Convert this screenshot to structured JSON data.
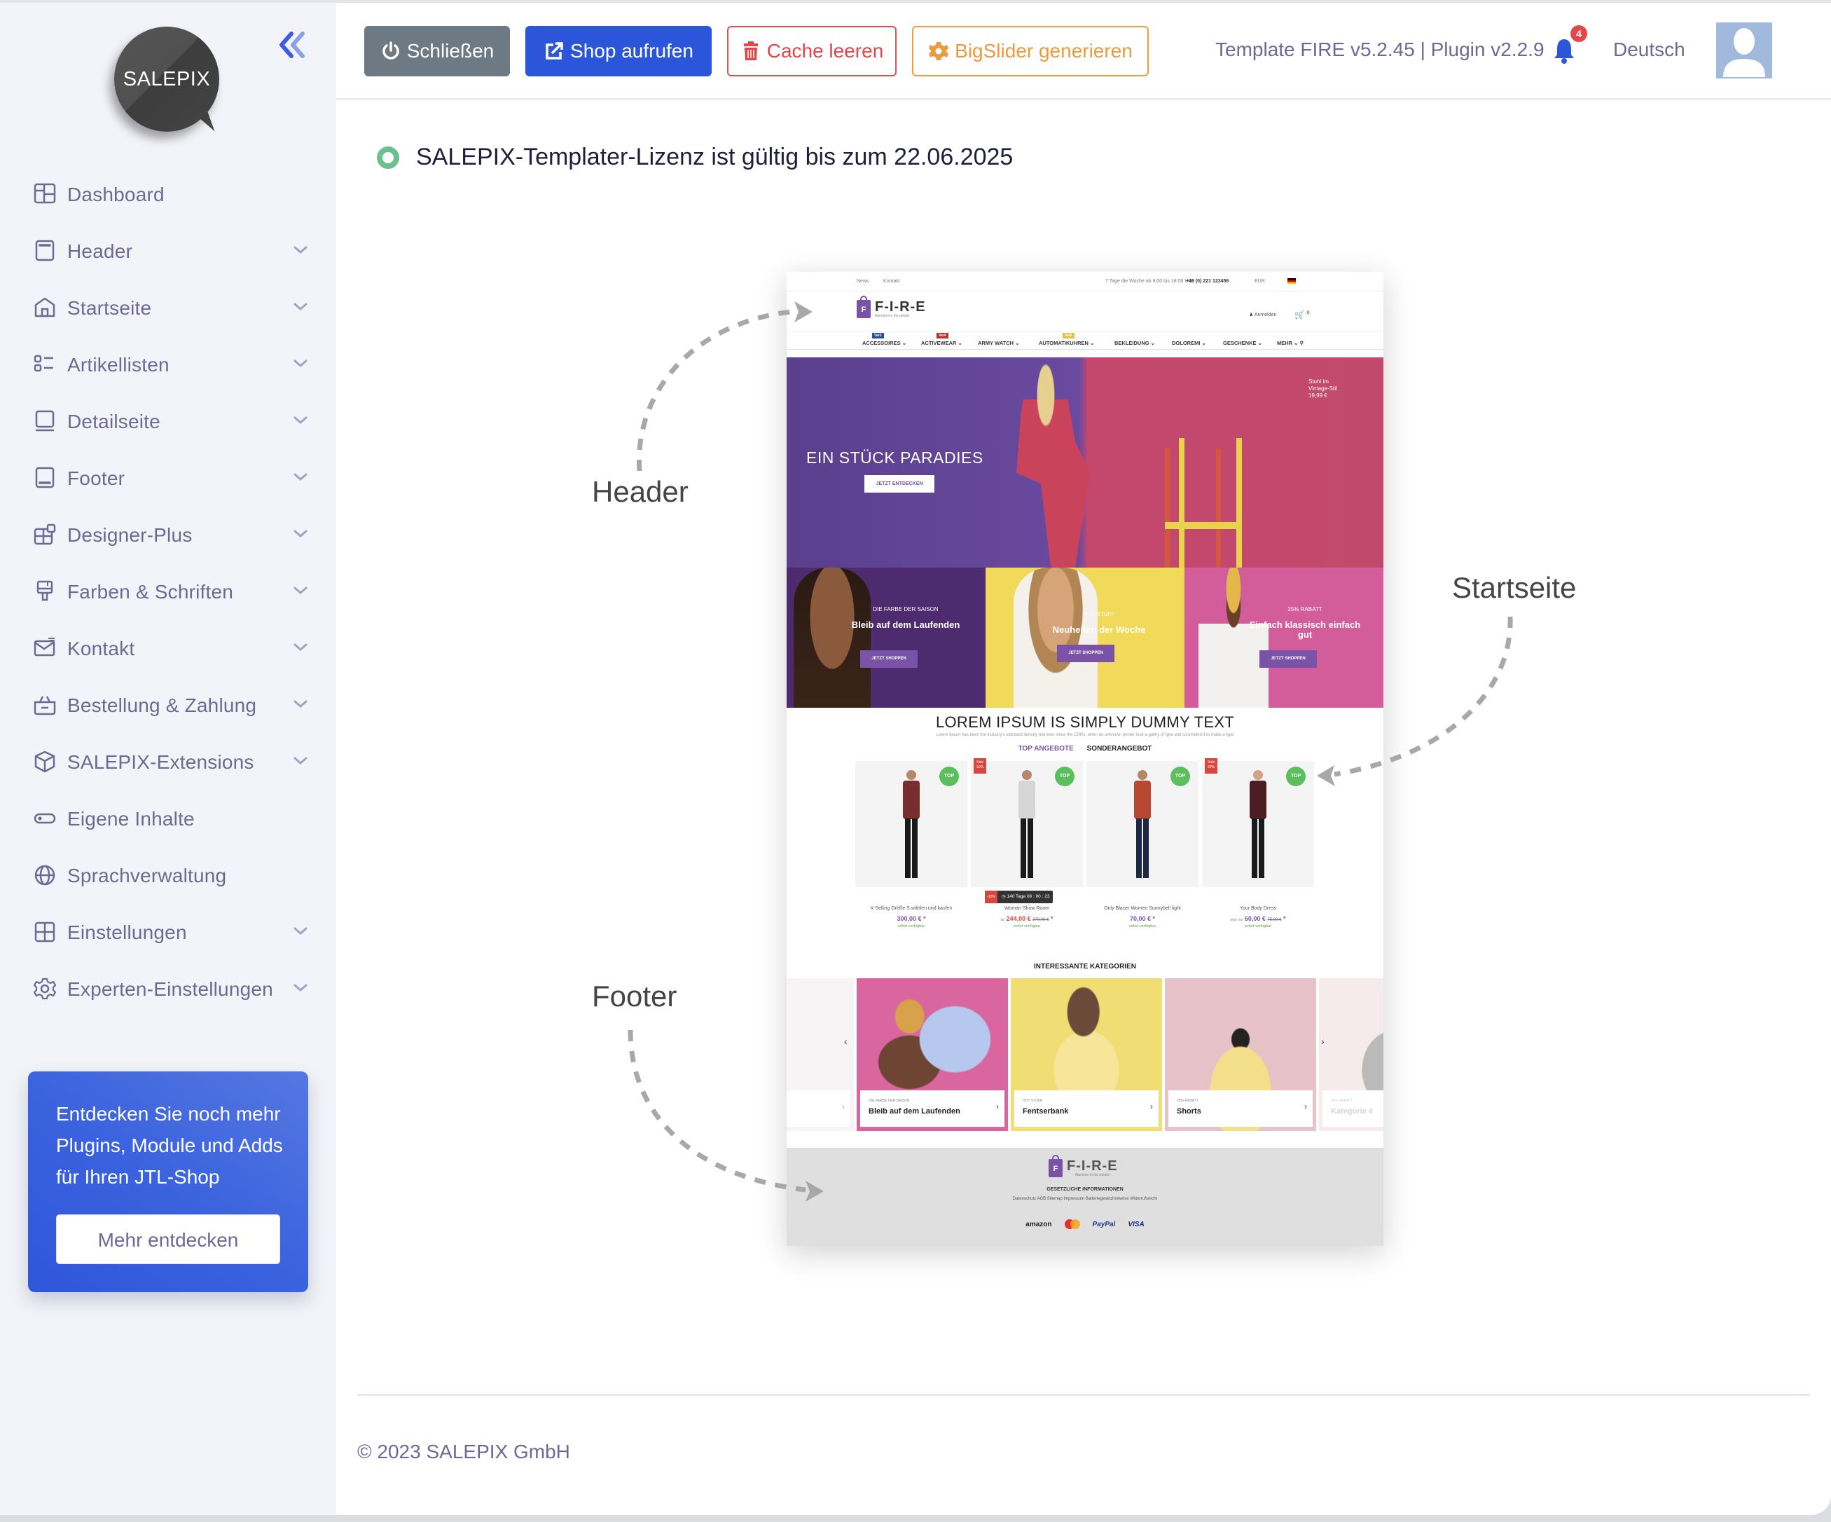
{
  "app": {
    "logo_text": "SALEPIX",
    "collapse_icon": "double-chevron-left-icon"
  },
  "sidebar": {
    "items": [
      {
        "label": "Dashboard",
        "icon": "dashboard-icon",
        "has_submenu": false
      },
      {
        "label": "Header",
        "icon": "header-layout-icon",
        "has_submenu": true
      },
      {
        "label": "Startseite",
        "icon": "home-icon",
        "has_submenu": true
      },
      {
        "label": "Artikellisten",
        "icon": "list-icon",
        "has_submenu": true
      },
      {
        "label": "Detailseite",
        "icon": "laptop-icon",
        "has_submenu": true
      },
      {
        "label": "Footer",
        "icon": "footer-layout-icon",
        "has_submenu": true
      },
      {
        "label": "Designer-Plus",
        "icon": "layout-plus-icon",
        "has_submenu": true
      },
      {
        "label": "Farben & Schriften",
        "icon": "paint-brush-icon",
        "has_submenu": true
      },
      {
        "label": "Kontakt",
        "icon": "mail-icon",
        "has_submenu": true
      },
      {
        "label": "Bestellung & Zahlung",
        "icon": "basket-icon",
        "has_submenu": true
      },
      {
        "label": "SALEPIX-Extensions",
        "icon": "box-icon",
        "has_submenu": true
      },
      {
        "label": "Eigene Inhalte",
        "icon": "toggle-icon",
        "has_submenu": false
      },
      {
        "label": "Sprachverwaltung",
        "icon": "globe-icon",
        "has_submenu": false
      },
      {
        "label": "Einstellungen",
        "icon": "grid-icon",
        "has_submenu": true
      },
      {
        "label": "Experten-Einstellungen",
        "icon": "gear-icon",
        "has_submenu": true
      }
    ],
    "promo": {
      "text": "Entdecken Sie noch mehr Plugins, Module und Adds für Ihren JTL-Shop",
      "button_label": "Mehr entdecken"
    }
  },
  "toolbar": {
    "close_label": "Schließen",
    "shop_label": "Shop aufrufen",
    "cache_label": "Cache leeren",
    "bigslider_label": "BigSlider generieren",
    "version_text": "Template FIRE v5.2.45 | Plugin v2.2.9",
    "notification_count": "4",
    "language": "Deutsch"
  },
  "main": {
    "license_text": "SALEPIX-Templater-Lizenz ist gültig bis zum 22.06.2025",
    "license_status_color": "#6cc08e",
    "annotations": {
      "header": "Header",
      "startseite": "Startseite",
      "footer": "Footer"
    },
    "preview": {
      "topbar": {
        "links": [
          "News",
          "Kontakt"
        ],
        "hours": "7 Tage die Woche ab 9:00 bis 18:00 Uhr",
        "phone": "+49 (0) 221 123456",
        "currency": "EUR"
      },
      "brand": "F-I-R-E",
      "brand_letter": "F",
      "tagline": "Attention to the details",
      "login": "Anmelden",
      "cart_count": "0",
      "nav": [
        {
          "label": "ACCESSOIRES",
          "tag": "Var2",
          "tag_color": "#2a4a9c"
        },
        {
          "label": "ACTIVEWEAR",
          "tag": "Var4",
          "tag_color": "#b6312c"
        },
        {
          "label": "ARMY WATCH",
          "tag": "",
          "tag_color": ""
        },
        {
          "label": "AUTOMATIKUHREN",
          "tag": "Var5",
          "tag_color": "#e3c04d"
        },
        {
          "label": "BEKLEIDUNG",
          "tag": "",
          "tag_color": ""
        },
        {
          "label": "DOLOREMI",
          "tag": "",
          "tag_color": ""
        },
        {
          "label": "GESCHENKE",
          "tag": "",
          "tag_color": ""
        },
        {
          "label": "MEHR",
          "tag": "",
          "tag_color": ""
        }
      ],
      "hero": {
        "title": "EIN STÜCK PARADIES",
        "button": "JETZT ENTDECKEN",
        "side_text": [
          "Stuhl im",
          "Vintage-Stil",
          "19,99 €"
        ]
      },
      "tiles": [
        {
          "kicker": "DIE FARBE DER SAISON",
          "title": "Bleib auf dem Laufenden",
          "button": "JETZT SHOPPEN",
          "bg": "#4e2a6e"
        },
        {
          "kicker": "HOT STUFF",
          "title": "Neuheiten der Woche",
          "button": "JETZT SHOPPEN",
          "bg": "#f1d95a"
        },
        {
          "kicker": "25% RABATT",
          "title": "Einfach klassisch einfach gut",
          "button": "JETZT SHOPPEN",
          "bg": "#d35c9a"
        }
      ],
      "section_title": "LOREM IPSUM IS SIMPLY DUMMY TEXT",
      "section_text": "Lorem Ipsum has been the industry's standard dummy text ever since the 1500s, when an unknown printer took a galley of type and scrambled it to make a type",
      "tabs": [
        "TOP ANGEBOTE",
        "SONDERANGEBOT"
      ],
      "products": [
        {
          "name": "X-Selling Größe S wählen und kaufen",
          "price": "300,00 € *",
          "prefix": "",
          "old_price": "",
          "availability": "sofort verfügbar",
          "badge": "TOP",
          "sale": "",
          "shirt": "#7a2d2f",
          "pants": "#1a1a1a"
        },
        {
          "name": "Woman Show Room",
          "price": "244,00 €",
          "prefix": "ab",
          "old_price": "270,00 €",
          "availability": "sofort verfügbar",
          "badge": "TOP",
          "sale": "Sale 10%",
          "countdown_discount": "-10%",
          "countdown": "140 Tage 08 : 00 : 23",
          "shirt": "#d6d6d6",
          "pants": "#1a1a1a"
        },
        {
          "name": "Only Blazer Women Sunnybell light",
          "price": "70,00 € *",
          "prefix": "",
          "old_price": "",
          "availability": "sofort verfügbar",
          "badge": "TOP",
          "sale": "",
          "shirt": "#b8482f",
          "pants": "#1e2744"
        },
        {
          "name": "Your Body Dress",
          "price": "60,00 €",
          "prefix": "jetzt nur",
          "old_price": "75,00 €",
          "availability": "sofort verfügbar",
          "badge": "TOP",
          "sale": "Sale 20%",
          "shirt": "#4a1e24",
          "pants": "#1a1a1a"
        }
      ],
      "categories_title": "INTERESSANTE KATEGORIEN",
      "categories": [
        {
          "kicker": "",
          "title": "",
          "bg": "#eee4e8",
          "faded": true
        },
        {
          "kicker": "DIE FARBE DER SAISON",
          "title": "Bleib auf dem Laufenden",
          "bg": "#d9669f",
          "faded": false
        },
        {
          "kicker": "HOT STUFF",
          "title": "Fentserbank",
          "bg": "#f0dd74",
          "faded": false
        },
        {
          "kicker": "25% RABATT",
          "title": "Shorts",
          "bg": "#e8c2c9",
          "faded": false
        },
        {
          "kicker": "25% RABATT",
          "title": "Kategorie 4",
          "bg": "#e8cfd4",
          "faded": true
        }
      ],
      "footer": {
        "heading": "GESETZLICHE INFORMATIONEN",
        "links": "Datenschutz  AGB  Sitemap  Impressum  Batteriegesetzhinweise  Widerrufsrecht",
        "payments": [
          "amazon",
          "mastercard",
          "PayPal",
          "VISA"
        ]
      }
    }
  },
  "footer": {
    "copyright": "© 2023 SALEPIX GmbH"
  },
  "colors": {
    "primary": "#2c56d9",
    "sidebar_text": "#6f6896",
    "danger": "#e35053",
    "warning": "#ec9e47",
    "secondary": "#6d7a84"
  }
}
